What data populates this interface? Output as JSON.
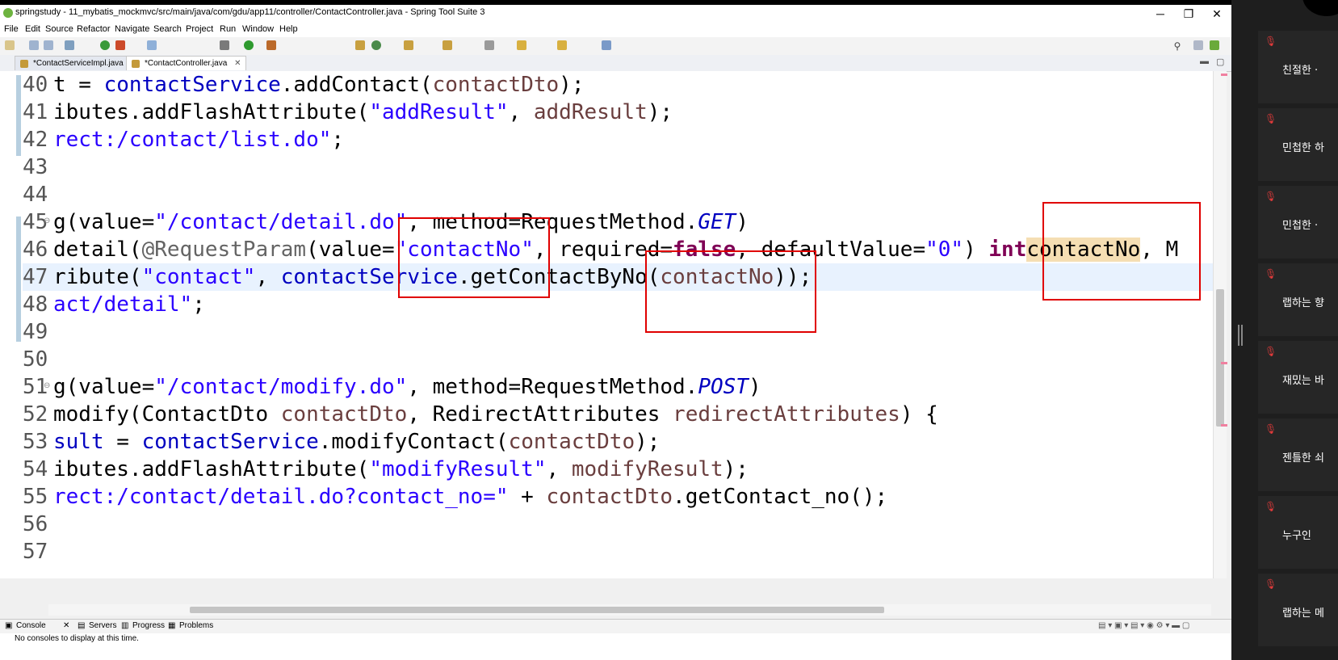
{
  "window": {
    "title": "springstudy - 11_mybatis_mockmvc/src/main/java/com/gdu/app11/controller/ContactController.java - Spring Tool Suite 3",
    "minimize": "─",
    "maximize": "❐",
    "close": "✕"
  },
  "menu": [
    "File",
    "Edit",
    "Source",
    "Refactor",
    "Navigate",
    "Search",
    "Project",
    "Run",
    "Window",
    "Help"
  ],
  "tabs": [
    {
      "label": "*ContactServiceImpl.java",
      "active": false
    },
    {
      "label": "*ContactController.java",
      "active": true,
      "close": "✕"
    }
  ],
  "code": {
    "lines": [
      {
        "n": "40",
        "t": [
          [
            "",
            "t = "
          ],
          [
            "f",
            "contactService"
          ],
          [
            "",
            ".addContact("
          ],
          [
            "v",
            "contactDto"
          ],
          [
            "",
            ");"
          ]
        ]
      },
      {
        "n": "41",
        "t": [
          [
            "",
            "ibutes.addFlashAttribute("
          ],
          [
            "s",
            "\"addResult\""
          ],
          [
            "",
            ", "
          ],
          [
            "v",
            "addResult"
          ],
          [
            "",
            ");"
          ]
        ]
      },
      {
        "n": "42",
        "t": [
          [
            "s",
            "rect:/contact/list.do\""
          ],
          [
            "",
            ";"
          ]
        ]
      },
      {
        "n": "43",
        "t": []
      },
      {
        "n": "44",
        "t": []
      },
      {
        "n": "45",
        "t": [
          [
            "",
            "g(value="
          ],
          [
            "s",
            "\"/contact/detail.do\""
          ],
          [
            "",
            ", method=RequestMethod."
          ],
          [
            "it",
            "GET"
          ],
          [
            "",
            ")"
          ]
        ]
      },
      {
        "n": "46",
        "t": [
          [
            "",
            "detail("
          ],
          [
            "a",
            "@RequestParam"
          ],
          [
            "",
            "(value="
          ],
          [
            "s",
            "\"contactNo\""
          ],
          [
            "",
            ", required="
          ],
          [
            "k",
            "false"
          ],
          [
            "",
            ", defaultValue="
          ],
          [
            "s",
            "\"0\""
          ],
          [
            "",
            ") "
          ],
          [
            "k",
            "int"
          ],
          [
            "",
            ""
          ],
          [
            "hl",
            "contactNo"
          ],
          [
            "",
            ", M"
          ]
        ]
      },
      {
        "n": "47",
        "t": [
          [
            "",
            "ribute("
          ],
          [
            "s",
            "\"contact\""
          ],
          [
            "",
            ", "
          ],
          [
            "f",
            "contactService"
          ],
          [
            "",
            ".getContactByNo("
          ],
          [
            "v",
            "contactNo"
          ],
          [
            "",
            "));"
          ]
        ]
      },
      {
        "n": "48",
        "t": [
          [
            "s",
            "act/detail\""
          ],
          [
            "",
            ";"
          ]
        ]
      },
      {
        "n": "49",
        "t": []
      },
      {
        "n": "50",
        "t": []
      },
      {
        "n": "51",
        "t": [
          [
            "",
            "g(value="
          ],
          [
            "s",
            "\"/contact/modify.do\""
          ],
          [
            "",
            ", method=RequestMethod."
          ],
          [
            "it",
            "POST"
          ],
          [
            "",
            ")"
          ]
        ]
      },
      {
        "n": "52",
        "t": [
          [
            "",
            "modify(ContactDto "
          ],
          [
            "v",
            "contactDto"
          ],
          [
            "",
            ", RedirectAttributes "
          ],
          [
            "v",
            "redirectAttributes"
          ],
          [
            "",
            ") {"
          ]
        ]
      },
      {
        "n": "53",
        "t": [
          [
            "f",
            "sult"
          ],
          [
            "",
            " = "
          ],
          [
            "f",
            "contactService"
          ],
          [
            "",
            ".modifyContact("
          ],
          [
            "v",
            "contactDto"
          ],
          [
            "",
            ");"
          ]
        ]
      },
      {
        "n": "54",
        "t": [
          [
            "",
            "ibutes.addFlashAttribute("
          ],
          [
            "s",
            "\"modifyResult\""
          ],
          [
            "",
            ", "
          ],
          [
            "v",
            "modifyResult"
          ],
          [
            "",
            ");"
          ]
        ]
      },
      {
        "n": "55",
        "t": [
          [
            "s",
            "rect:/contact/detail.do?contact_no=\""
          ],
          [
            "",
            " + "
          ],
          [
            "v",
            "contactDto"
          ],
          [
            "",
            ".getContact_no();"
          ]
        ]
      },
      {
        "n": "56",
        "t": []
      },
      {
        "n": "57",
        "t": []
      }
    ]
  },
  "console": {
    "tabs": [
      "Console",
      "Servers",
      "Progress",
      "Problems"
    ],
    "message": "No consoles to display at this time."
  },
  "participants": [
    {
      "name": "친절한 ·"
    },
    {
      "name": "민첩한 하"
    },
    {
      "name": "민첩한 ·"
    },
    {
      "name": "랩하는 향"
    },
    {
      "name": "재밌는 바"
    },
    {
      "name": "젠틀한 쇠"
    },
    {
      "name": "누구인"
    },
    {
      "name": "랩하는 메"
    }
  ],
  "colors": {
    "annotation_box": "#e00000",
    "keyword": "#7f0055",
    "field": "#0000c0",
    "string": "#2a00ff"
  }
}
